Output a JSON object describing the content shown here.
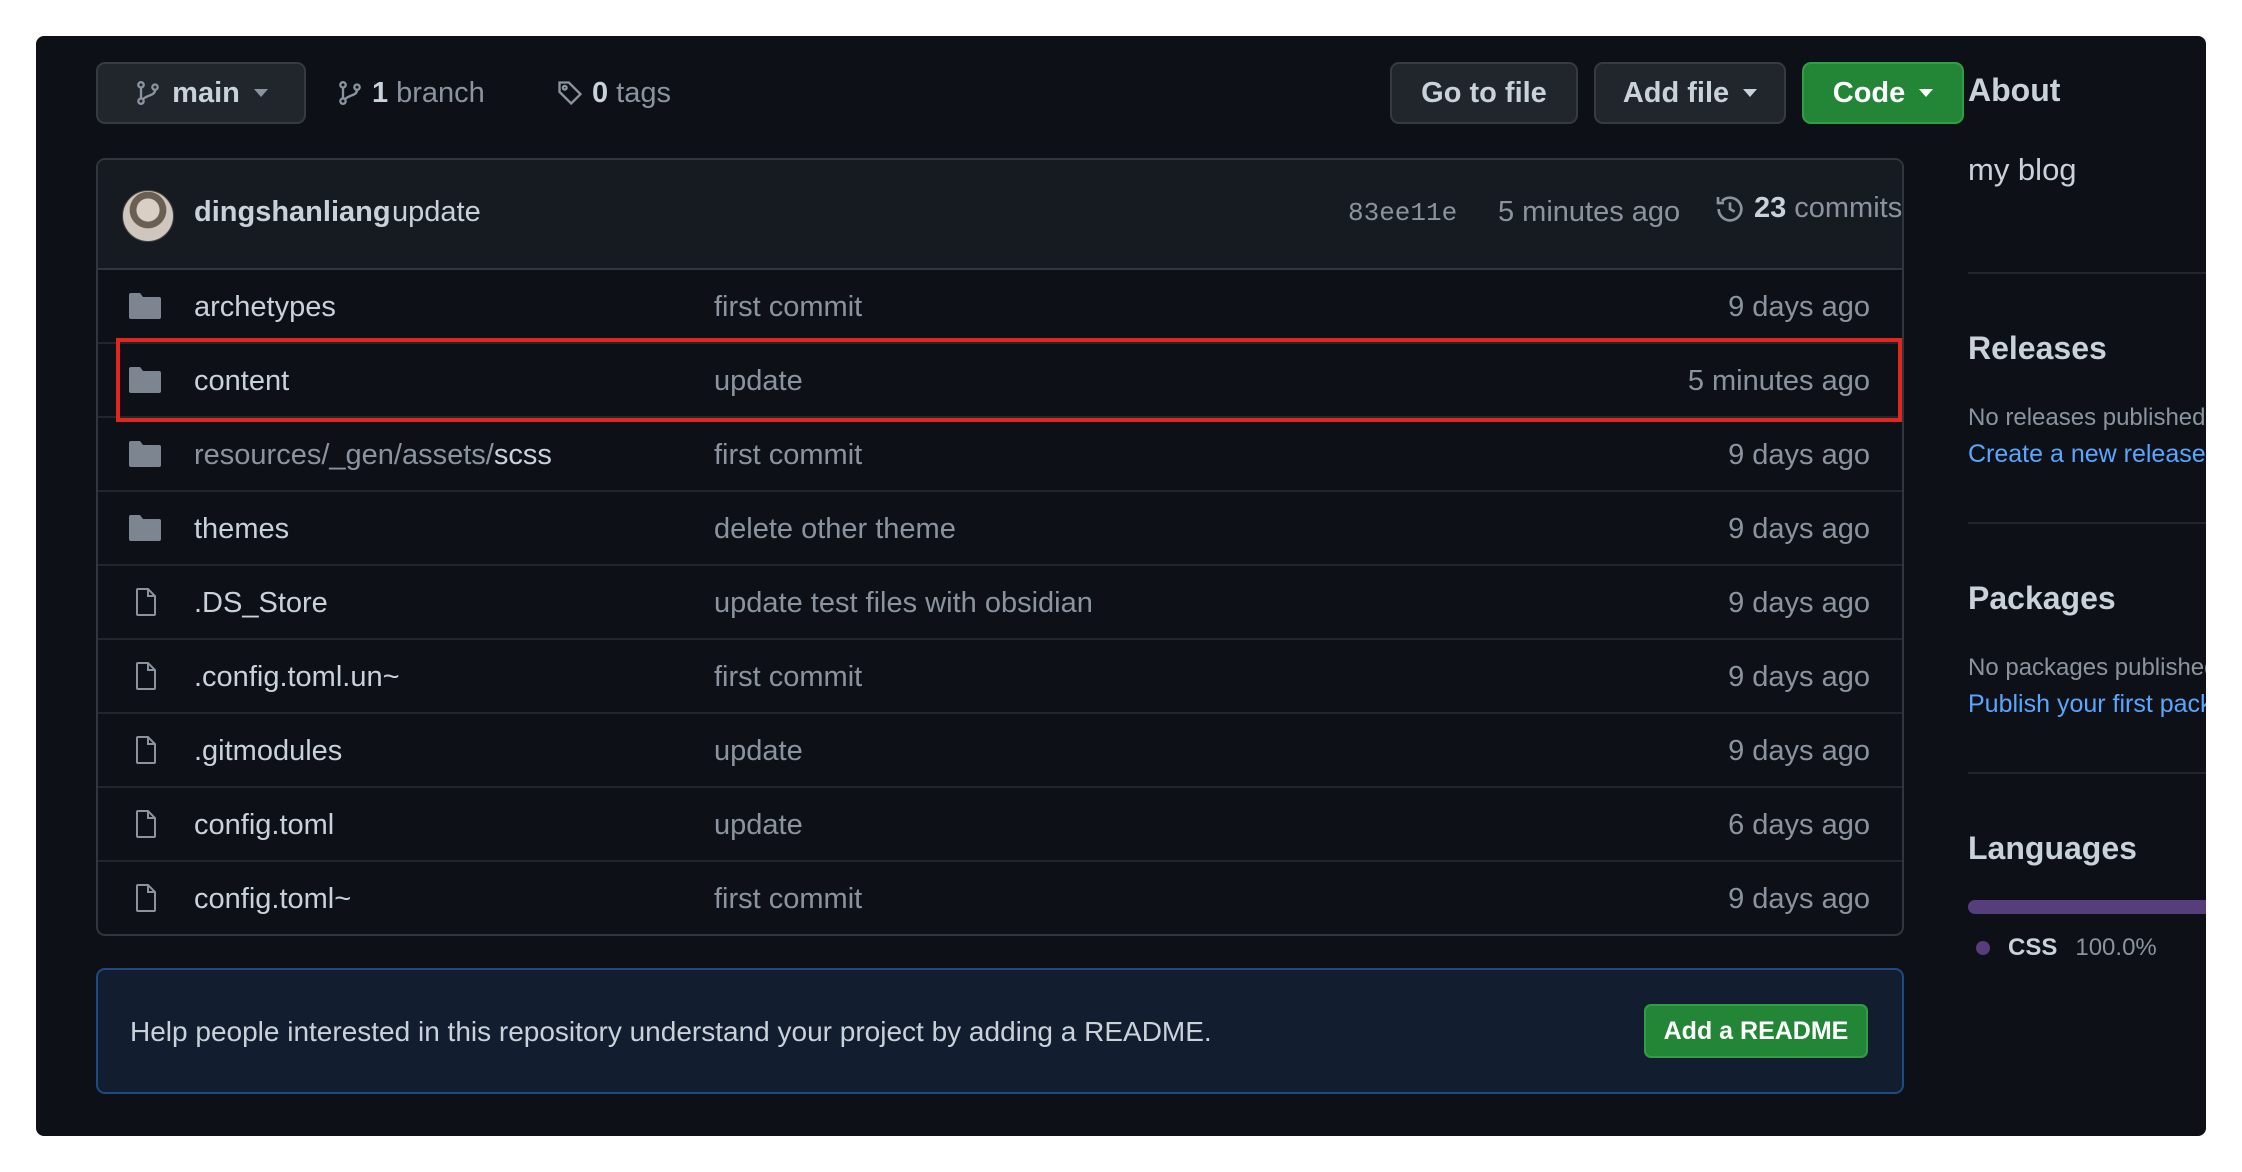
{
  "toolbar": {
    "branch_name": "main",
    "branch_count": "1",
    "branch_label": "branch",
    "tag_count": "0",
    "tag_label": "tags",
    "go_to_file": "Go to file",
    "add_file": "Add file",
    "code": "Code"
  },
  "latest_commit": {
    "author": "dingshanliang",
    "message": "update",
    "sha": "83ee11e",
    "time": "5 minutes ago",
    "count": "23",
    "count_label": "commits"
  },
  "files": [
    {
      "type": "folder",
      "name": "archetypes",
      "message": "first commit",
      "age": "9 days ago"
    },
    {
      "type": "folder",
      "name": "content",
      "message": "update",
      "age": "5 minutes ago"
    },
    {
      "type": "folder",
      "name_prefix": "resources/_gen/assets/",
      "name": "scss",
      "message": "first commit",
      "age": "9 days ago"
    },
    {
      "type": "folder",
      "name": "themes",
      "message": "delete other theme",
      "age": "9 days ago"
    },
    {
      "type": "file",
      "name": ".DS_Store",
      "message": "update test files with obsidian",
      "age": "9 days ago"
    },
    {
      "type": "file",
      "name": ".config.toml.un~",
      "message": "first commit",
      "age": "9 days ago"
    },
    {
      "type": "file",
      "name": ".gitmodules",
      "message": "update",
      "age": "9 days ago"
    },
    {
      "type": "file",
      "name": "config.toml",
      "message": "update",
      "age": "6 days ago"
    },
    {
      "type": "file",
      "name": "config.toml~",
      "message": "first commit",
      "age": "9 days ago"
    }
  ],
  "readme_banner": {
    "text": "Help people interested in this repository understand your project by adding a README.",
    "button": "Add a README"
  },
  "sidebar": {
    "about_heading": "About",
    "description": "my blog",
    "releases_heading": "Releases",
    "releases_empty": "No releases published",
    "releases_link": "Create a new release",
    "packages_heading": "Packages",
    "packages_empty": "No packages published",
    "packages_link": "Publish your first package",
    "languages_heading": "Languages",
    "language_name": "CSS",
    "language_percent": "100.0%"
  },
  "colors": {
    "background": "#0d1117",
    "accent_green": "#238636",
    "link_blue": "#58a6ff",
    "highlight_red": "#e0271c",
    "css_language": "#563d7c"
  }
}
